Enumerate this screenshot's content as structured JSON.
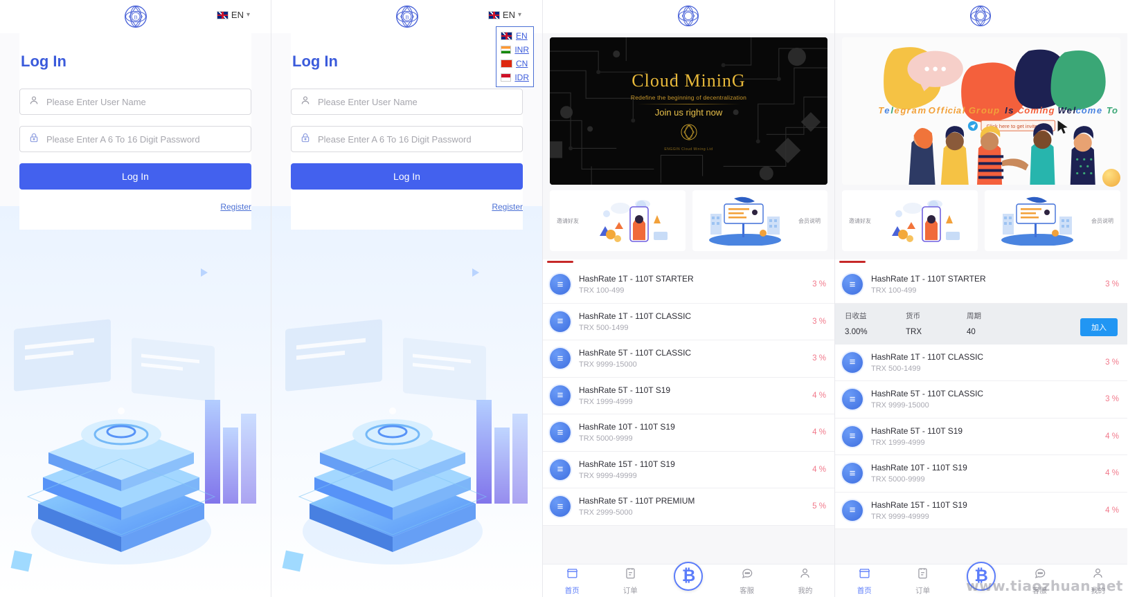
{
  "app": {
    "logo_icon": "app-logo-icon",
    "watermark": "www.tiaozhuan.net"
  },
  "language": {
    "current": "EN",
    "current_flag": "flag-en-icon",
    "caret_icon": "chevron-down-icon",
    "options": [
      {
        "code": "EN",
        "flag": "flag-en-icon"
      },
      {
        "code": "INR",
        "flag": "flag-inr-icon"
      },
      {
        "code": "CN",
        "flag": "flag-cn-icon"
      },
      {
        "code": "IDR",
        "flag": "flag-idr-icon"
      }
    ]
  },
  "login": {
    "title": "Log In",
    "username_placeholder": "Please Enter User Name",
    "username_value": "",
    "username_icon": "user-icon",
    "password_placeholder": "Please Enter A 6 To 16 Digit Password",
    "password_value": "",
    "password_icon": "lock-icon",
    "submit_label": "Log In",
    "register_label": "Register"
  },
  "banner_mining": {
    "title": "Cloud MininG",
    "subtitle": "Redefine the beginning of decentralization",
    "cta": "Join us right now",
    "footer": "ENGGIN Cloud Mining Ltd"
  },
  "banner_telegram": {
    "title": "Telegram Official Group  Is Coming  Welcome To Join Us",
    "chip_label": "Click here to get invited link",
    "chip_icon": "telegram-icon"
  },
  "quick_cards": [
    {
      "label": "邀请好友",
      "art": "invite-friends-illustration"
    },
    {
      "label": "会员说明",
      "art": "member-guide-illustration"
    }
  ],
  "products": [
    {
      "name": "HashRate 1T - 110T STARTER",
      "range": "TRX 100-499",
      "rate": "3 %"
    },
    {
      "name": "HashRate 1T - 110T CLASSIC",
      "range": "TRX 500-1499",
      "rate": "3 %"
    },
    {
      "name": "HashRate 5T - 110T CLASSIC",
      "range": "TRX 9999-15000",
      "rate": "3 %"
    },
    {
      "name": "HashRate 5T - 110T S19",
      "range": "TRX 1999-4999",
      "rate": "4 %"
    },
    {
      "name": "HashRate 10T - 110T S19",
      "range": "TRX 5000-9999",
      "rate": "4 %"
    },
    {
      "name": "HashRate 15T - 110T S19",
      "range": "TRX 9999-49999",
      "rate": "4 %"
    },
    {
      "name": "HashRate 5T - 110T PREMIUM",
      "range": "TRX 2999-5000",
      "rate": "5 %"
    }
  ],
  "detail_panel": {
    "headers": {
      "daily": "日收益",
      "currency": "货币",
      "period": "周期"
    },
    "values": {
      "daily": "3.00%",
      "currency": "TRX",
      "period": "40"
    },
    "join_label": "加入"
  },
  "tabbar": [
    {
      "label": "首页",
      "icon": "home-store-icon",
      "active": true
    },
    {
      "label": "订单",
      "icon": "orders-icon",
      "active": false
    },
    {
      "label": "",
      "icon": "bitcoin-icon",
      "active": false
    },
    {
      "label": "客服",
      "icon": "chat-support-icon",
      "active": false
    },
    {
      "label": "我的",
      "icon": "user-profile-icon",
      "active": false
    }
  ],
  "colors": {
    "primary": "#4361ee",
    "accent": "#5b7cfa",
    "rate": "#f1788a",
    "tab_indicator": "#c62828",
    "join_button": "#2196f3",
    "gold": "#e8b93a"
  }
}
